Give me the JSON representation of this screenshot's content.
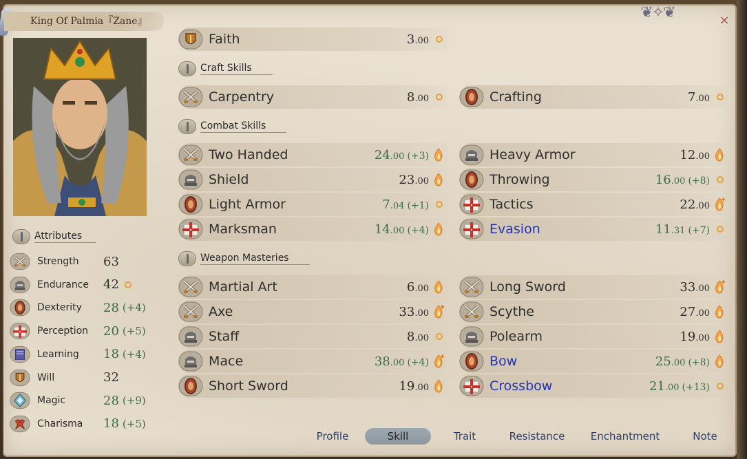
{
  "window": {
    "character_name": "King Of Palmia『Zane』",
    "close_glyph": "×"
  },
  "attributes": {
    "header": "Attributes",
    "items": [
      {
        "name": "Strength",
        "value": "63",
        "bonus": "",
        "icon": "crossed-swords-icon"
      },
      {
        "name": "Endurance",
        "value": "42",
        "bonus": "",
        "icon": "helmet-icon",
        "potential": "dot"
      },
      {
        "name": "Dexterity",
        "value": "28",
        "bonus": "(+4)",
        "icon": "red-gem-icon"
      },
      {
        "name": "Perception",
        "value": "20",
        "bonus": "(+5)",
        "icon": "target-cross-icon"
      },
      {
        "name": "Learning",
        "value": "18",
        "bonus": "(+4)",
        "icon": "book-icon"
      },
      {
        "name": "Will",
        "value": "32",
        "bonus": "",
        "icon": "shield-icon"
      },
      {
        "name": "Magic",
        "value": "28",
        "bonus": "(+9)",
        "icon": "magic-crystal-icon"
      },
      {
        "name": "Charisma",
        "value": "18",
        "bonus": "(+5)",
        "icon": "ribbon-icon"
      }
    ]
  },
  "faith": {
    "name": "Faith",
    "int": "3",
    "dec": ".00",
    "bonus": "",
    "potential": "dot"
  },
  "sections": {
    "craft": "Craft Skills",
    "combat": "Combat Skills",
    "weapon": "Weapon Masteries"
  },
  "craft_skills": [
    {
      "name": "Carpentry",
      "int": "8",
      "dec": ".00",
      "bonus": "",
      "potential": "dot",
      "icon": "crossed-swords-icon"
    },
    {
      "name": "Crafting",
      "int": "7",
      "dec": ".00",
      "bonus": "",
      "potential": "dot",
      "icon": "red-gem-icon"
    }
  ],
  "combat_left": [
    {
      "name": "Two Handed",
      "int": "24",
      "dec": ".00",
      "bonus": "(+3)",
      "potential": "flame",
      "icon": "crossed-swords-icon",
      "green": true
    },
    {
      "name": "Shield",
      "int": "23",
      "dec": ".00",
      "bonus": "",
      "potential": "flame",
      "icon": "helmet-icon"
    },
    {
      "name": "Light Armor",
      "int": "7",
      "dec": ".04",
      "bonus": "(+1)",
      "potential": "dot",
      "icon": "red-gem-icon",
      "green": true
    },
    {
      "name": "Marksman",
      "int": "14",
      "dec": ".00",
      "bonus": "(+4)",
      "potential": "flame",
      "icon": "target-cross-icon",
      "green": true
    }
  ],
  "combat_right": [
    {
      "name": "Heavy Armor",
      "int": "12",
      "dec": ".00",
      "bonus": "",
      "potential": "flame",
      "icon": "helmet-icon"
    },
    {
      "name": "Throwing",
      "int": "16",
      "dec": ".00",
      "bonus": "(+8)",
      "potential": "dot",
      "icon": "red-gem-icon",
      "green": true
    },
    {
      "name": "Tactics",
      "int": "22",
      "dec": ".00",
      "bonus": "",
      "potential": "flame-plus",
      "icon": "target-cross-icon"
    },
    {
      "name": "Evasion",
      "int": "11",
      "dec": ".31",
      "bonus": "(+7)",
      "potential": "dot",
      "icon": "target-cross-icon",
      "green": true,
      "blue_name": true
    }
  ],
  "weapon_left": [
    {
      "name": "Martial Art",
      "int": "6",
      "dec": ".00",
      "bonus": "",
      "potential": "flame",
      "icon": "crossed-swords-icon"
    },
    {
      "name": "Axe",
      "int": "33",
      "dec": ".00",
      "bonus": "",
      "potential": "flame-plus",
      "icon": "crossed-swords-icon"
    },
    {
      "name": "Staff",
      "int": "8",
      "dec": ".00",
      "bonus": "",
      "potential": "dot",
      "icon": "helmet-icon"
    },
    {
      "name": "Mace",
      "int": "38",
      "dec": ".00",
      "bonus": "(+4)",
      "potential": "flame-plus",
      "icon": "helmet-icon",
      "green": true
    },
    {
      "name": "Short Sword",
      "int": "19",
      "dec": ".00",
      "bonus": "",
      "potential": "flame",
      "icon": "red-gem-icon"
    }
  ],
  "weapon_right": [
    {
      "name": "Long Sword",
      "int": "33",
      "dec": ".00",
      "bonus": "",
      "potential": "flame-plus",
      "icon": "crossed-swords-icon"
    },
    {
      "name": "Scythe",
      "int": "27",
      "dec": ".00",
      "bonus": "",
      "potential": "flame",
      "icon": "crossed-swords-icon"
    },
    {
      "name": "Polearm",
      "int": "19",
      "dec": ".00",
      "bonus": "",
      "potential": "flame",
      "icon": "helmet-icon"
    },
    {
      "name": "Bow",
      "int": "25",
      "dec": ".00",
      "bonus": "(+8)",
      "potential": "flame",
      "icon": "red-gem-icon",
      "green": true,
      "blue_name": true
    },
    {
      "name": "Crossbow",
      "int": "21",
      "dec": ".00",
      "bonus": "(+13)",
      "potential": "dot",
      "icon": "target-cross-icon",
      "green": true,
      "blue_name": true
    }
  ],
  "tabs": [
    {
      "label": "Profile",
      "active": false
    },
    {
      "label": "Skill",
      "active": true
    },
    {
      "label": "Trait",
      "active": false
    },
    {
      "label": "Resistance",
      "active": false
    },
    {
      "label": "Enchantment",
      "active": false
    },
    {
      "label": "Note",
      "active": false
    }
  ],
  "colors": {
    "panel_bg": "#e9e0d1",
    "bonus_green": "#3e6d4d",
    "link_blue": "#1f34b8",
    "potential_orange": "#e6a03a",
    "close_red": "#b45050"
  }
}
